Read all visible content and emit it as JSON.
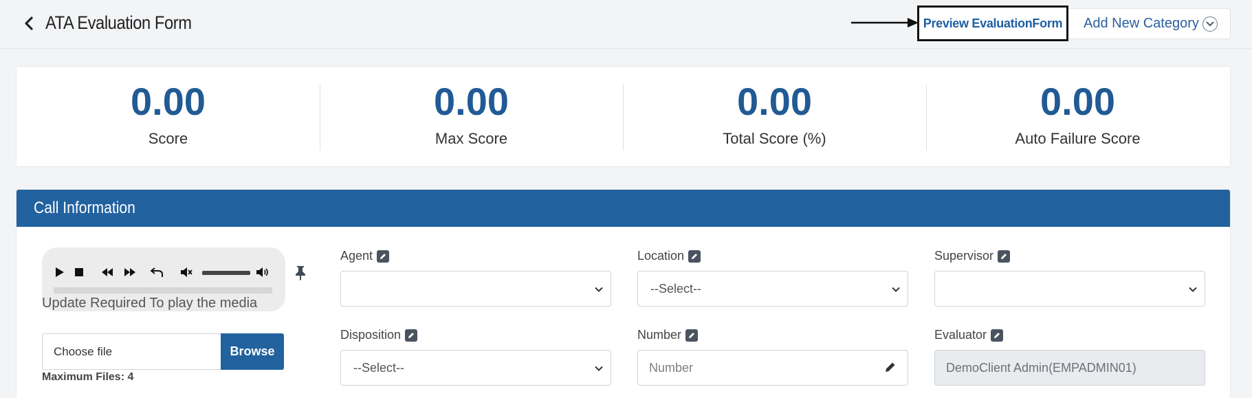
{
  "header": {
    "title": "ATA Evaluation Form",
    "preview_label": "Preview EvaluationForm",
    "add_category_label": "Add New Category"
  },
  "stats": [
    {
      "value": "0.00",
      "label": "Score"
    },
    {
      "value": "0.00",
      "label": "Max Score"
    },
    {
      "value": "0.00",
      "label": "Total Score (%)"
    },
    {
      "value": "0.00",
      "label": "Auto Failure Score"
    }
  ],
  "call_info": {
    "title": "Call Information",
    "player": {
      "update_text": "Update Required To play the media",
      "volume_level": 1.0
    },
    "file": {
      "placeholder": "Choose file",
      "browse_label": "Browse",
      "max_files": "Maximum Files: 4"
    },
    "fields": {
      "agent": {
        "label": "Agent",
        "value": ""
      },
      "location": {
        "label": "Location",
        "value": "--Select--"
      },
      "supervisor": {
        "label": "Supervisor",
        "value": ""
      },
      "disposition": {
        "label": "Disposition",
        "value": "--Select--"
      },
      "number": {
        "label": "Number",
        "placeholder": "Number"
      },
      "evaluator": {
        "label": "Evaluator",
        "value": "DemoClient Admin(EMPADMIN01)"
      }
    }
  },
  "colors": {
    "primary": "#22629f",
    "stat_value": "#215a94",
    "background": "#f3f4f6"
  }
}
